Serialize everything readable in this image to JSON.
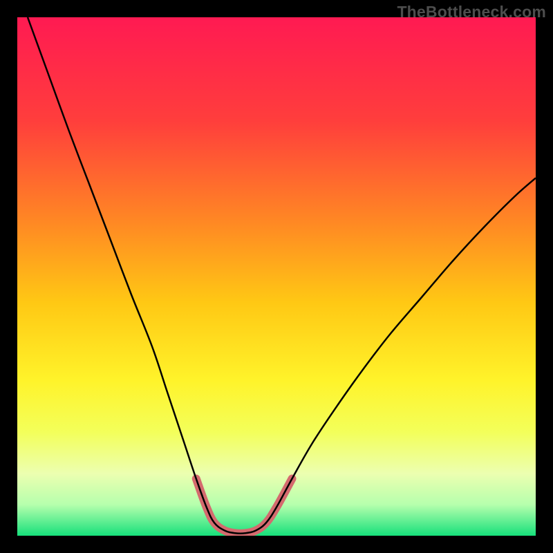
{
  "watermark": "TheBottleneck.com",
  "chart_data": {
    "type": "line",
    "title": "",
    "xlabel": "",
    "ylabel": "",
    "xlim": [
      0,
      100
    ],
    "ylim": [
      0,
      100
    ],
    "background_gradient": {
      "stops": [
        {
          "offset": 0,
          "color": "#ff1a52"
        },
        {
          "offset": 20,
          "color": "#ff3e3c"
        },
        {
          "offset": 40,
          "color": "#ff8a23"
        },
        {
          "offset": 55,
          "color": "#ffc814"
        },
        {
          "offset": 70,
          "color": "#fff32a"
        },
        {
          "offset": 80,
          "color": "#f3ff5a"
        },
        {
          "offset": 88,
          "color": "#ecffb0"
        },
        {
          "offset": 94,
          "color": "#b6ffad"
        },
        {
          "offset": 100,
          "color": "#16e07b"
        }
      ]
    },
    "series": [
      {
        "name": "bottleneck-curve",
        "stroke": "#000000",
        "stroke_width": 2.5,
        "points": [
          {
            "x": 2.0,
            "y": 100.0
          },
          {
            "x": 6.0,
            "y": 89.0
          },
          {
            "x": 10.0,
            "y": 78.0
          },
          {
            "x": 14.0,
            "y": 67.5
          },
          {
            "x": 18.0,
            "y": 57.0
          },
          {
            "x": 22.0,
            "y": 46.5
          },
          {
            "x": 26.0,
            "y": 36.5
          },
          {
            "x": 29.0,
            "y": 27.5
          },
          {
            "x": 32.0,
            "y": 18.5
          },
          {
            "x": 34.5,
            "y": 11.0
          },
          {
            "x": 36.5,
            "y": 5.5
          },
          {
            "x": 38.0,
            "y": 2.5
          },
          {
            "x": 40.0,
            "y": 1.0
          },
          {
            "x": 42.0,
            "y": 0.5
          },
          {
            "x": 44.0,
            "y": 0.5
          },
          {
            "x": 46.0,
            "y": 1.0
          },
          {
            "x": 48.0,
            "y": 2.5
          },
          {
            "x": 50.0,
            "y": 5.5
          },
          {
            "x": 53.0,
            "y": 11.0
          },
          {
            "x": 57.0,
            "y": 18.0
          },
          {
            "x": 62.0,
            "y": 25.5
          },
          {
            "x": 67.0,
            "y": 32.5
          },
          {
            "x": 72.0,
            "y": 39.0
          },
          {
            "x": 78.0,
            "y": 46.0
          },
          {
            "x": 84.0,
            "y": 53.0
          },
          {
            "x": 90.0,
            "y": 59.5
          },
          {
            "x": 96.0,
            "y": 65.5
          },
          {
            "x": 100.0,
            "y": 69.0
          }
        ]
      },
      {
        "name": "optimal-zone-marker",
        "stroke": "#d46a6e",
        "stroke_width": 12,
        "linecap": "round",
        "points": [
          {
            "x": 34.5,
            "y": 11.0
          },
          {
            "x": 36.5,
            "y": 5.5
          },
          {
            "x": 38.0,
            "y": 2.5
          },
          {
            "x": 40.0,
            "y": 1.0
          },
          {
            "x": 42.0,
            "y": 0.5
          },
          {
            "x": 44.0,
            "y": 0.5
          },
          {
            "x": 46.0,
            "y": 1.0
          },
          {
            "x": 48.0,
            "y": 2.5
          },
          {
            "x": 50.0,
            "y": 5.5
          },
          {
            "x": 53.0,
            "y": 11.0
          }
        ]
      }
    ]
  }
}
